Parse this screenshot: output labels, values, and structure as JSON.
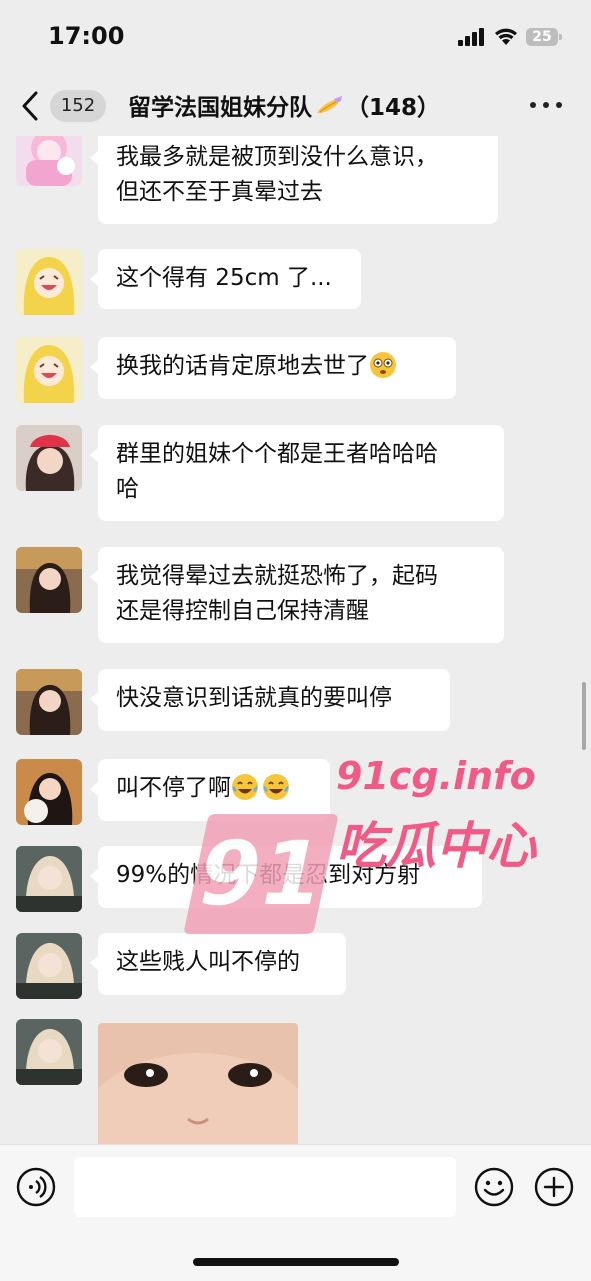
{
  "status_bar": {
    "time": "17:00",
    "battery": "25"
  },
  "nav": {
    "unread_count": "152",
    "title": "留学法国姐妹分队",
    "member_count": "（148）",
    "title_emoji": "nail-polish-icon"
  },
  "messages": [
    {
      "avatar": "avatar-pink-anime-girl",
      "lines": [
        "我最多就是被顶到没什么意识，",
        "但还不至于真晕过去"
      ]
    },
    {
      "avatar": "avatar-blonde-anime-girl",
      "lines": [
        "这个得有 25cm 了..."
      ]
    },
    {
      "avatar": "avatar-blonde-anime-girl",
      "lines": [
        "换我的话肯定原地去世了"
      ],
      "trailing_emoji": "flushed-face-icon"
    },
    {
      "avatar": "avatar-red-hat-girl",
      "lines": [
        "群里的姐妹个个都是王者哈哈哈",
        "哈"
      ]
    },
    {
      "avatar": "avatar-long-hair-girl",
      "lines": [
        "我觉得晕过去就挺恐怖了，起码",
        "还是得控制自己保持清醒"
      ]
    },
    {
      "avatar": "avatar-long-hair-girl",
      "lines": [
        "快没意识到话就真的要叫停"
      ]
    },
    {
      "avatar": "avatar-girl-with-dog",
      "lines": [
        "叫不停了啊"
      ],
      "trailing_emoji": "laughing-tears-face-icon x2"
    },
    {
      "avatar": "avatar-selfie-girl",
      "lines": [
        "99%的情况下都是忍到对方射"
      ]
    },
    {
      "avatar": "avatar-selfie-girl",
      "lines": [
        "这些贱人叫不停的"
      ]
    },
    {
      "avatar": "avatar-selfie-girl",
      "image": "baby-face-photo"
    }
  ],
  "watermark": {
    "logo_number": "91",
    "site": "91cg.info",
    "name": "吃瓜中心"
  },
  "colors": {
    "background": "#ededed",
    "bubble": "#ffffff",
    "watermark": "#ef5b86"
  }
}
